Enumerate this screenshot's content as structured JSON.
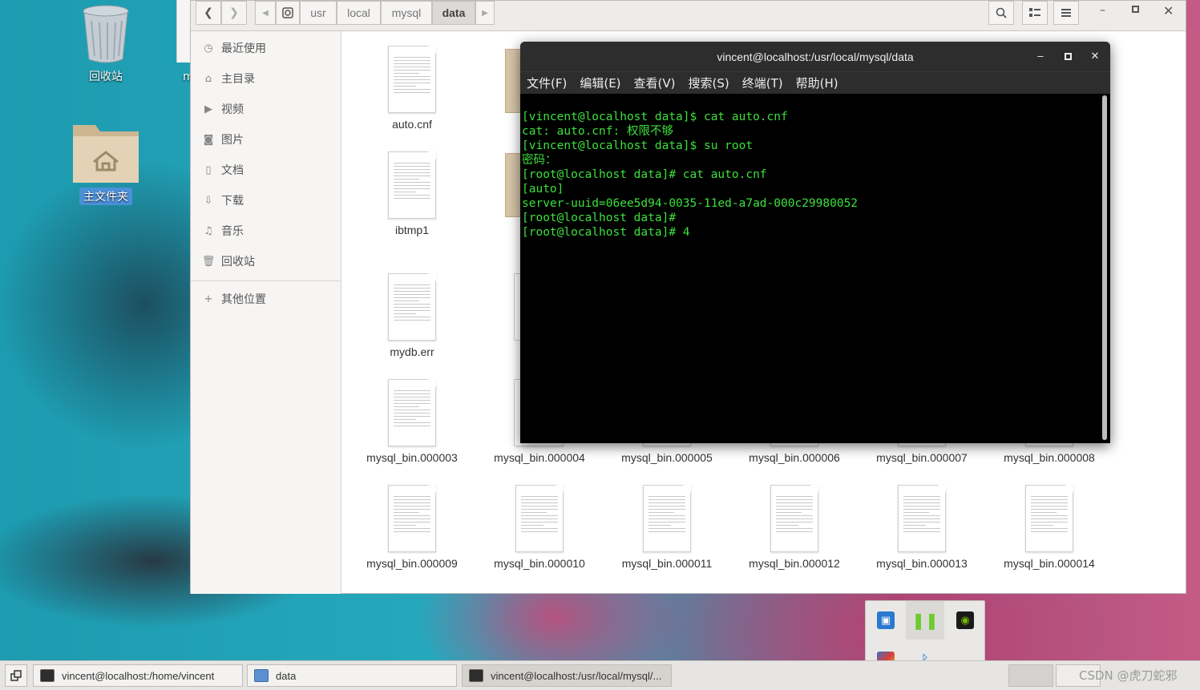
{
  "desktop": {
    "icons": [
      {
        "label": "回收站",
        "icon": "trash-icon"
      },
      {
        "label": "主文件夹",
        "icon": "home-folder-icon"
      }
    ]
  },
  "file_manager": {
    "breadcrumbs": [
      "usr",
      "local",
      "mysql",
      "data"
    ],
    "active_crumb": "data",
    "sidebar": [
      {
        "label": "最近使用",
        "icon": "recent-icon"
      },
      {
        "label": "主目录",
        "icon": "home-icon"
      },
      {
        "label": "视频",
        "icon": "video-icon"
      },
      {
        "label": "图片",
        "icon": "picture-icon"
      },
      {
        "label": "文档",
        "icon": "document-icon"
      },
      {
        "label": "下载",
        "icon": "download-icon"
      },
      {
        "label": "音乐",
        "icon": "music-icon"
      },
      {
        "label": "回收站",
        "icon": "trash-icon"
      },
      {
        "label": "其他位置",
        "icon": "plus-icon"
      }
    ],
    "files": [
      "auto.cnf",
      "ibtmp1",
      "mydb.err",
      "mysql_bin.000003",
      "mysql_bin.000004",
      "mysql_bin.000005",
      "mysql_bin.000006",
      "mysql_bin.000007",
      "mysql_bin.000008",
      "mysql_bin.000009",
      "mysql_bin.000010",
      "mysql_bin.000011",
      "mysql_bin.000012",
      "mysql_bin.000013",
      "mysql_bin.000014"
    ]
  },
  "terminal": {
    "title": "vincent@localhost:/usr/local/mysql/data",
    "menu": [
      "文件(F)",
      "编辑(E)",
      "查看(V)",
      "搜索(S)",
      "终端(T)",
      "帮助(H)"
    ],
    "lines": [
      "[vincent@localhost data]$ cat auto.cnf",
      "cat: auto.cnf: 权限不够",
      "[vincent@localhost data]$ su root",
      "密码：",
      "[root@localhost data]# cat auto.cnf",
      "[auto]",
      "server-uuid=06ee5d94-0035-11ed-a7ad-000c29980052",
      "[root@localhost data]#",
      "[root@localhost data]# 4"
    ]
  },
  "taskbar": {
    "tasks": [
      {
        "label": "vincent@localhost:/home/vincent",
        "icon": "terminal-icon"
      },
      {
        "label": "data",
        "icon": "file-manager-icon"
      },
      {
        "label": "vincent@localhost:/usr/local/mysql/...",
        "icon": "terminal-icon"
      }
    ],
    "watermark": "CSDN @虎刀蛇邪"
  }
}
